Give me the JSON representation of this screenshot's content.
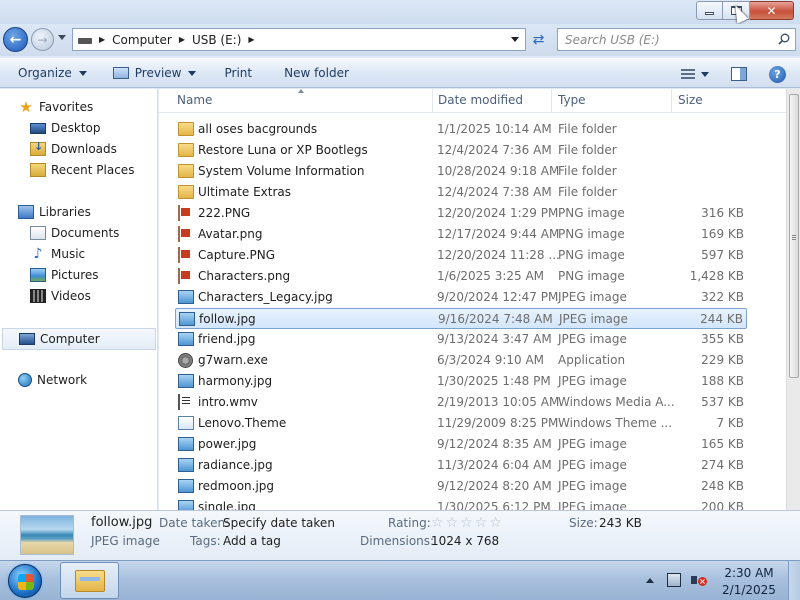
{
  "window": {
    "minimize_label": "",
    "maximize_label": "",
    "close_label": "✕"
  },
  "address": {
    "crumbs": [
      "Computer",
      "USB (E:)"
    ],
    "search_placeholder": "Search USB (E:)"
  },
  "toolbar": {
    "organize": "Organize",
    "preview": "Preview",
    "print": "Print",
    "new_folder": "New folder"
  },
  "nav": {
    "favorites": "Favorites",
    "desktop": "Desktop",
    "downloads": "Downloads",
    "recent_places": "Recent Places",
    "libraries": "Libraries",
    "documents": "Documents",
    "music": "Music",
    "pictures": "Pictures",
    "videos": "Videos",
    "computer": "Computer",
    "network": "Network"
  },
  "columns": {
    "name": "Name",
    "date": "Date modified",
    "type": "Type",
    "size": "Size"
  },
  "files": [
    {
      "name": "all oses bacgrounds",
      "date": "1/1/2025 10:14 AM",
      "type": "File folder",
      "size": "",
      "icon": "folder-icon"
    },
    {
      "name": "Restore Luna or XP Bootlegs",
      "date": "12/4/2024 7:36 AM",
      "type": "File folder",
      "size": "",
      "icon": "folder-icon"
    },
    {
      "name": "System Volume Information",
      "date": "10/28/2024 9:18 AM",
      "type": "File folder",
      "size": "",
      "icon": "folder-icon"
    },
    {
      "name": "Ultimate Extras",
      "date": "12/4/2024 7:38 AM",
      "type": "File folder",
      "size": "",
      "icon": "folder-icon"
    },
    {
      "name": "222.PNG",
      "date": "12/20/2024 1:29 PM",
      "type": "PNG image",
      "size": "316 KB",
      "icon": "png-icon"
    },
    {
      "name": "Avatar.png",
      "date": "12/17/2024 9:44 AM",
      "type": "PNG image",
      "size": "169 KB",
      "icon": "png-icon"
    },
    {
      "name": "Capture.PNG",
      "date": "12/20/2024 11:28 ...",
      "type": "PNG image",
      "size": "597 KB",
      "icon": "png-icon"
    },
    {
      "name": "Characters.png",
      "date": "1/6/2025 3:25 AM",
      "type": "PNG image",
      "size": "1,428 KB",
      "icon": "png-icon"
    },
    {
      "name": "Characters_Legacy.jpg",
      "date": "9/20/2024 12:47 PM",
      "type": "JPEG image",
      "size": "322 KB",
      "icon": "jpeg-icon"
    },
    {
      "name": "follow.jpg",
      "date": "9/16/2024 7:48 AM",
      "type": "JPEG image",
      "size": "244 KB",
      "icon": "jpeg-icon",
      "selected": true
    },
    {
      "name": "friend.jpg",
      "date": "9/13/2024 3:47 AM",
      "type": "JPEG image",
      "size": "355 KB",
      "icon": "jpeg-icon"
    },
    {
      "name": "g7warn.exe",
      "date": "6/3/2024 9:10 AM",
      "type": "Application",
      "size": "229 KB",
      "icon": "application-icon"
    },
    {
      "name": "harmony.jpg",
      "date": "1/30/2025 1:48 PM",
      "type": "JPEG image",
      "size": "188 KB",
      "icon": "jpeg-icon"
    },
    {
      "name": "intro.wmv",
      "date": "2/19/2013 10:05 AM",
      "type": "Windows Media A...",
      "size": "537 KB",
      "icon": "video-file-icon"
    },
    {
      "name": "Lenovo.Theme",
      "date": "11/29/2009 8:25 PM",
      "type": "Windows Theme ...",
      "size": "7 KB",
      "icon": "theme-file-icon"
    },
    {
      "name": "power.jpg",
      "date": "9/12/2024 8:35 AM",
      "type": "JPEG image",
      "size": "165 KB",
      "icon": "jpeg-icon"
    },
    {
      "name": "radiance.jpg",
      "date": "11/3/2024 6:04 AM",
      "type": "JPEG image",
      "size": "274 KB",
      "icon": "jpeg-icon"
    },
    {
      "name": "redmoon.jpg",
      "date": "9/12/2024 8:20 AM",
      "type": "JPEG image",
      "size": "248 KB",
      "icon": "jpeg-icon"
    },
    {
      "name": "single.jpg",
      "date": "1/30/2025 6:12 PM",
      "type": "JPEG image",
      "size": "200 KB",
      "icon": "jpeg-icon"
    }
  ],
  "details": {
    "filename": "follow.jpg",
    "filetype": "JPEG image",
    "date_taken_label": "Date taken:",
    "date_taken_value": "Specify date taken",
    "tags_label": "Tags:",
    "tags_value": "Add a tag",
    "rating_label": "Rating:",
    "rating_value": 0,
    "dimensions_label": "Dimensions:",
    "dimensions_value": "1024 x 768",
    "size_label": "Size:",
    "size_value": "243 KB"
  },
  "taskbar": {
    "time": "2:30 AM",
    "date": "2/1/2025"
  }
}
